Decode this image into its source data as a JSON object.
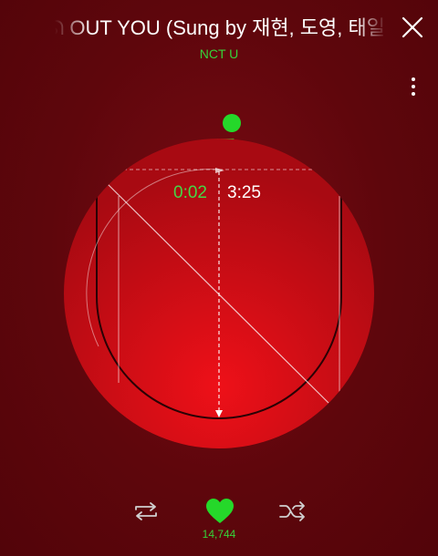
{
  "player": {
    "song_title": "ᘏ OUT YOU (Sung by 재현, 도영, 태일",
    "artist": "NCT U",
    "elapsed": "0:02",
    "total": "3:25",
    "progress_fraction": 0.01,
    "like_count": "14,744"
  },
  "icons": {
    "close": "close-icon",
    "menu": "more-vertical-icon",
    "repeat": "repeat-icon",
    "like": "heart-icon",
    "shuffle": "shuffle-icon"
  },
  "colors": {
    "background": "#5e060c",
    "disc_top": "#a80a12",
    "disc_bottom": "#ee1018",
    "accent_green": "#25d82a"
  }
}
